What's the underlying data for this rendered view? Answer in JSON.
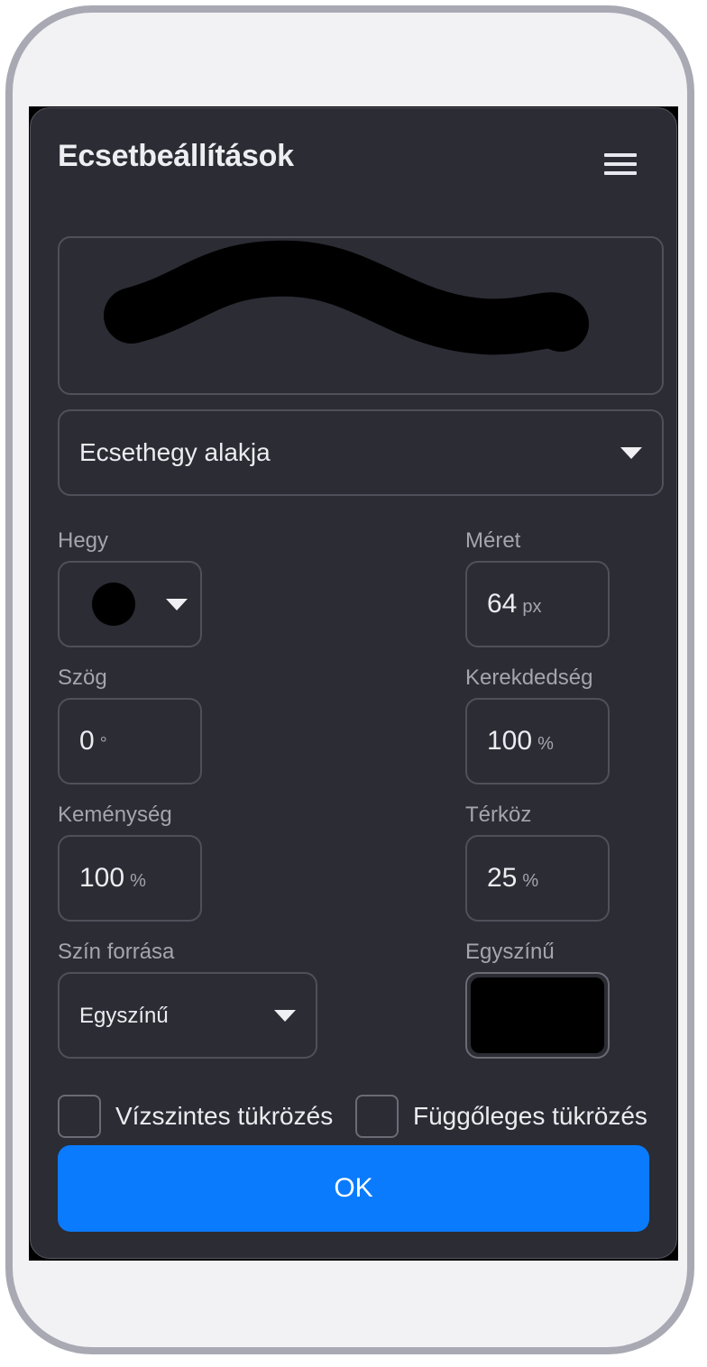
{
  "panel": {
    "title": "Ecsetbeállítások",
    "menu_icon": "hamburger-menu-icon",
    "preview": {
      "stroke_color": "#000000"
    },
    "tip_shape_select": {
      "label": "Ecsethegy alakja"
    }
  },
  "fields": {
    "tip": {
      "label": "Hegy",
      "shape": "round"
    },
    "size": {
      "label": "Méret",
      "value": "64",
      "unit": "px"
    },
    "angle": {
      "label": "Szög",
      "value": "0",
      "unit": "°"
    },
    "roundness": {
      "label": "Kerekdedség",
      "value": "100",
      "unit": "%"
    },
    "hardness": {
      "label": "Keménység",
      "value": "100",
      "unit": "%"
    },
    "spacing": {
      "label": "Térköz",
      "value": "25",
      "unit": "%"
    },
    "color_source": {
      "label": "Szín forrása",
      "value": "Egyszínű"
    },
    "solid_color": {
      "label": "Egyszínű",
      "color": "#000000"
    }
  },
  "options": {
    "flip_horizontal": {
      "label": "Vízszintes tükrözés",
      "checked": false
    },
    "flip_vertical": {
      "label": "Függőleges tükrözés",
      "checked": false
    }
  },
  "actions": {
    "ok_label": "OK"
  },
  "colors": {
    "accent": "#0a7bfc",
    "panel_bg": "#2b2c34"
  }
}
